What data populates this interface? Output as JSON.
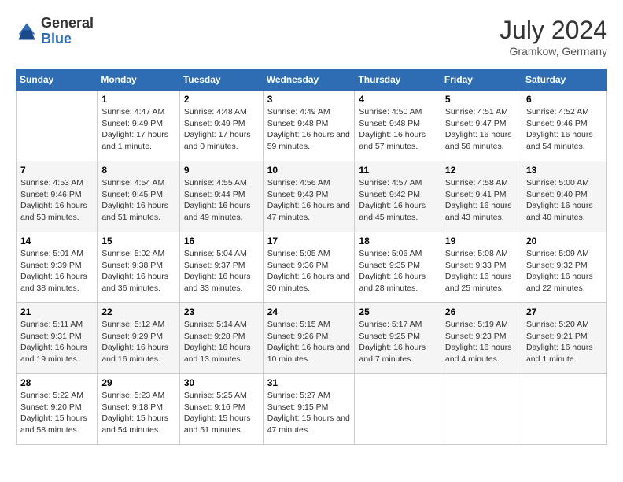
{
  "header": {
    "logo_general": "General",
    "logo_blue": "Blue",
    "month_year": "July 2024",
    "location": "Gramkow, Germany"
  },
  "days_of_week": [
    "Sunday",
    "Monday",
    "Tuesday",
    "Wednesday",
    "Thursday",
    "Friday",
    "Saturday"
  ],
  "weeks": [
    [
      {
        "day": "",
        "sunrise": "",
        "sunset": "",
        "daylight": ""
      },
      {
        "day": "1",
        "sunrise": "Sunrise: 4:47 AM",
        "sunset": "Sunset: 9:49 PM",
        "daylight": "Daylight: 17 hours and 1 minute."
      },
      {
        "day": "2",
        "sunrise": "Sunrise: 4:48 AM",
        "sunset": "Sunset: 9:49 PM",
        "daylight": "Daylight: 17 hours and 0 minutes."
      },
      {
        "day": "3",
        "sunrise": "Sunrise: 4:49 AM",
        "sunset": "Sunset: 9:48 PM",
        "daylight": "Daylight: 16 hours and 59 minutes."
      },
      {
        "day": "4",
        "sunrise": "Sunrise: 4:50 AM",
        "sunset": "Sunset: 9:48 PM",
        "daylight": "Daylight: 16 hours and 57 minutes."
      },
      {
        "day": "5",
        "sunrise": "Sunrise: 4:51 AM",
        "sunset": "Sunset: 9:47 PM",
        "daylight": "Daylight: 16 hours and 56 minutes."
      },
      {
        "day": "6",
        "sunrise": "Sunrise: 4:52 AM",
        "sunset": "Sunset: 9:46 PM",
        "daylight": "Daylight: 16 hours and 54 minutes."
      }
    ],
    [
      {
        "day": "7",
        "sunrise": "Sunrise: 4:53 AM",
        "sunset": "Sunset: 9:46 PM",
        "daylight": "Daylight: 16 hours and 53 minutes."
      },
      {
        "day": "8",
        "sunrise": "Sunrise: 4:54 AM",
        "sunset": "Sunset: 9:45 PM",
        "daylight": "Daylight: 16 hours and 51 minutes."
      },
      {
        "day": "9",
        "sunrise": "Sunrise: 4:55 AM",
        "sunset": "Sunset: 9:44 PM",
        "daylight": "Daylight: 16 hours and 49 minutes."
      },
      {
        "day": "10",
        "sunrise": "Sunrise: 4:56 AM",
        "sunset": "Sunset: 9:43 PM",
        "daylight": "Daylight: 16 hours and 47 minutes."
      },
      {
        "day": "11",
        "sunrise": "Sunrise: 4:57 AM",
        "sunset": "Sunset: 9:42 PM",
        "daylight": "Daylight: 16 hours and 45 minutes."
      },
      {
        "day": "12",
        "sunrise": "Sunrise: 4:58 AM",
        "sunset": "Sunset: 9:41 PM",
        "daylight": "Daylight: 16 hours and 43 minutes."
      },
      {
        "day": "13",
        "sunrise": "Sunrise: 5:00 AM",
        "sunset": "Sunset: 9:40 PM",
        "daylight": "Daylight: 16 hours and 40 minutes."
      }
    ],
    [
      {
        "day": "14",
        "sunrise": "Sunrise: 5:01 AM",
        "sunset": "Sunset: 9:39 PM",
        "daylight": "Daylight: 16 hours and 38 minutes."
      },
      {
        "day": "15",
        "sunrise": "Sunrise: 5:02 AM",
        "sunset": "Sunset: 9:38 PM",
        "daylight": "Daylight: 16 hours and 36 minutes."
      },
      {
        "day": "16",
        "sunrise": "Sunrise: 5:04 AM",
        "sunset": "Sunset: 9:37 PM",
        "daylight": "Daylight: 16 hours and 33 minutes."
      },
      {
        "day": "17",
        "sunrise": "Sunrise: 5:05 AM",
        "sunset": "Sunset: 9:36 PM",
        "daylight": "Daylight: 16 hours and 30 minutes."
      },
      {
        "day": "18",
        "sunrise": "Sunrise: 5:06 AM",
        "sunset": "Sunset: 9:35 PM",
        "daylight": "Daylight: 16 hours and 28 minutes."
      },
      {
        "day": "19",
        "sunrise": "Sunrise: 5:08 AM",
        "sunset": "Sunset: 9:33 PM",
        "daylight": "Daylight: 16 hours and 25 minutes."
      },
      {
        "day": "20",
        "sunrise": "Sunrise: 5:09 AM",
        "sunset": "Sunset: 9:32 PM",
        "daylight": "Daylight: 16 hours and 22 minutes."
      }
    ],
    [
      {
        "day": "21",
        "sunrise": "Sunrise: 5:11 AM",
        "sunset": "Sunset: 9:31 PM",
        "daylight": "Daylight: 16 hours and 19 minutes."
      },
      {
        "day": "22",
        "sunrise": "Sunrise: 5:12 AM",
        "sunset": "Sunset: 9:29 PM",
        "daylight": "Daylight: 16 hours and 16 minutes."
      },
      {
        "day": "23",
        "sunrise": "Sunrise: 5:14 AM",
        "sunset": "Sunset: 9:28 PM",
        "daylight": "Daylight: 16 hours and 13 minutes."
      },
      {
        "day": "24",
        "sunrise": "Sunrise: 5:15 AM",
        "sunset": "Sunset: 9:26 PM",
        "daylight": "Daylight: 16 hours and 10 minutes."
      },
      {
        "day": "25",
        "sunrise": "Sunrise: 5:17 AM",
        "sunset": "Sunset: 9:25 PM",
        "daylight": "Daylight: 16 hours and 7 minutes."
      },
      {
        "day": "26",
        "sunrise": "Sunrise: 5:19 AM",
        "sunset": "Sunset: 9:23 PM",
        "daylight": "Daylight: 16 hours and 4 minutes."
      },
      {
        "day": "27",
        "sunrise": "Sunrise: 5:20 AM",
        "sunset": "Sunset: 9:21 PM",
        "daylight": "Daylight: 16 hours and 1 minute."
      }
    ],
    [
      {
        "day": "28",
        "sunrise": "Sunrise: 5:22 AM",
        "sunset": "Sunset: 9:20 PM",
        "daylight": "Daylight: 15 hours and 58 minutes."
      },
      {
        "day": "29",
        "sunrise": "Sunrise: 5:23 AM",
        "sunset": "Sunset: 9:18 PM",
        "daylight": "Daylight: 15 hours and 54 minutes."
      },
      {
        "day": "30",
        "sunrise": "Sunrise: 5:25 AM",
        "sunset": "Sunset: 9:16 PM",
        "daylight": "Daylight: 15 hours and 51 minutes."
      },
      {
        "day": "31",
        "sunrise": "Sunrise: 5:27 AM",
        "sunset": "Sunset: 9:15 PM",
        "daylight": "Daylight: 15 hours and 47 minutes."
      },
      {
        "day": "",
        "sunrise": "",
        "sunset": "",
        "daylight": ""
      },
      {
        "day": "",
        "sunrise": "",
        "sunset": "",
        "daylight": ""
      },
      {
        "day": "",
        "sunrise": "",
        "sunset": "",
        "daylight": ""
      }
    ]
  ]
}
